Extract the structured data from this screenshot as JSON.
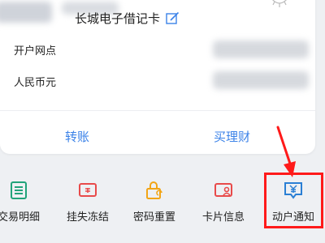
{
  "account": {
    "card_name": "长城电子借记卡",
    "open_branch_label": "开户网点",
    "currency_label": "人民币元"
  },
  "actions": {
    "transfer": "转账",
    "buy_wealth": "买理财"
  },
  "menu": [
    {
      "label": "交易明细",
      "icon": "transaction-list-icon",
      "color": "#21a37a"
    },
    {
      "label": "挂失冻结",
      "icon": "card-freeze-icon",
      "color": "#e84a4a"
    },
    {
      "label": "密码重置",
      "icon": "lock-reset-icon",
      "color": "#f2a516"
    },
    {
      "label": "卡片信息",
      "icon": "card-info-icon",
      "color": "#e84a4a"
    },
    {
      "label": "动户通知",
      "icon": "yen-notice-icon",
      "color": "#2a7fd4"
    }
  ],
  "highlight_color": "#ff1a1a",
  "accent_color": "#3b82e8"
}
